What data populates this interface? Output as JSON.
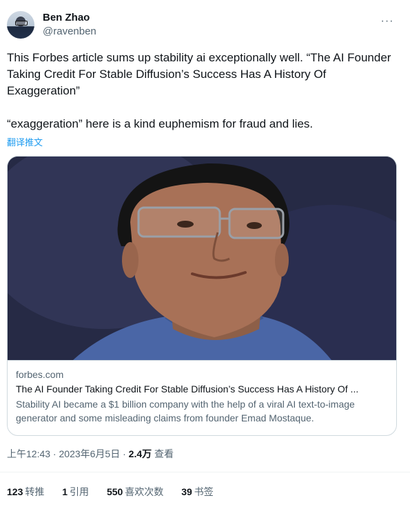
{
  "author": {
    "display_name": "Ben Zhao",
    "handle": "@ravenben"
  },
  "more_icon": "more-horizontal-icon",
  "tweet": {
    "text": "This Forbes article sums up stability ai exceptionally well. “The AI Founder Taking Credit For Stable Diffusion’s Success Has A History Of Exaggeration”\n\n“exaggeration” here is a kind euphemism for fraud and lies.",
    "translate_label": "翻译推文"
  },
  "card": {
    "domain": "forbes.com",
    "title": "The AI Founder Taking Credit For Stable Diffusion’s Success Has A History Of ...",
    "description": "Stability AI became a $1 billion company with the help of a viral AI text-to-image generator and some misleading claims from founder Emad Mostaque."
  },
  "meta": {
    "time": "上午12:43",
    "separator": " · ",
    "date": "2023年6月5日",
    "views_count": "2.4万",
    "views_label": "查看"
  },
  "stats": {
    "retweets": {
      "count": "123",
      "label": "转推"
    },
    "quotes": {
      "count": "1",
      "label": "引用"
    },
    "likes": {
      "count": "550",
      "label": "喜欢次数"
    },
    "bookmarks": {
      "count": "39",
      "label": "书签"
    }
  }
}
